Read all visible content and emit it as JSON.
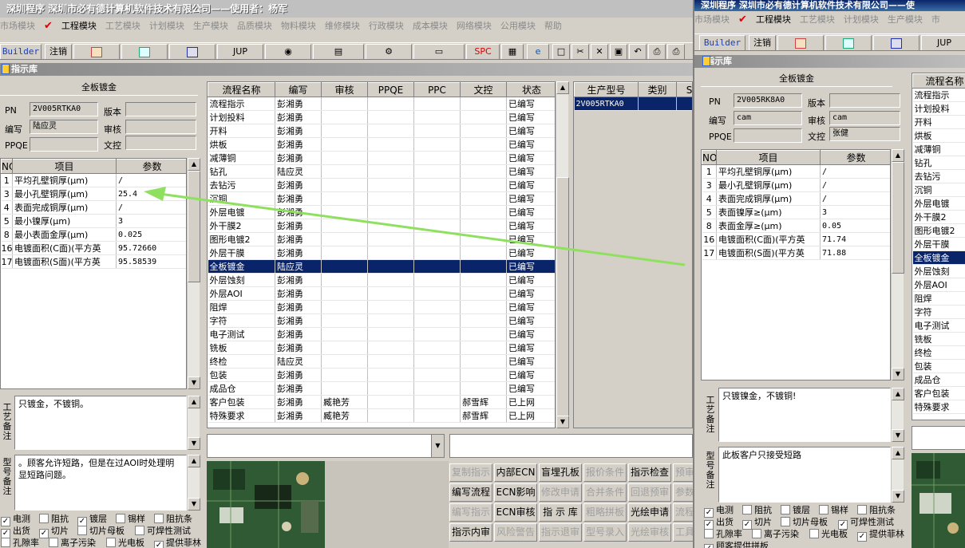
{
  "window1": {
    "title": "深圳程序   深圳市必有德计算机软件技术有限公司——使用者：杨军",
    "menu": [
      "市场模块",
      "工程模块",
      "工艺模块",
      "计划模块",
      "生产模块",
      "品质模块",
      "物料模块",
      "维修模块",
      "行政模块",
      "成本模块",
      "网络模块",
      "公用模块",
      "帮助"
    ],
    "toolbar": {
      "builder": "Builder",
      "logout": "注销",
      "jup": "JUP",
      "spc": "SPC"
    },
    "panel_title": "指示库",
    "process_name": "全板镀金",
    "pn_label": "PN",
    "pn_value": "2V005RTKA0",
    "version_label": "版本",
    "version_value": "",
    "writer_label": "编写",
    "writer_value": "陆应灵",
    "reviewer_label": "审核",
    "reviewer_value": "",
    "ppqe_label": "PPQE",
    "ppqe_value": "",
    "doc_label": "文控",
    "doc_value": "",
    "param_headers": [
      "NO",
      "项目",
      "参数"
    ],
    "params": [
      {
        "no": "1",
        "item": "平均孔壁铜厚(μm)",
        "value": "/"
      },
      {
        "no": "3",
        "item": "最小孔壁铜厚(μm)",
        "value": "25.4"
      },
      {
        "no": "4",
        "item": "表面完成铜厚(μm)",
        "value": "/"
      },
      {
        "no": "5",
        "item": "最小镍厚(μm)",
        "value": "3"
      },
      {
        "no": "8",
        "item": "最小表面金厚(μm)",
        "value": "0.025"
      },
      {
        "no": "16",
        "item": "电镀面积(C面)(平方英",
        "value": "95.72660"
      },
      {
        "no": "17",
        "item": "电镀面积(S面)(平方英",
        "value": "95.58539"
      }
    ],
    "process_headers": [
      "流程名称",
      "编写",
      "审核",
      "PPQE",
      "PPC",
      "文控",
      "状态"
    ],
    "processes": [
      [
        "流程指示",
        "彭湘勇",
        "",
        "",
        "",
        "",
        "已编写"
      ],
      [
        "计划投料",
        "彭湘勇",
        "",
        "",
        "",
        "",
        "已编写"
      ],
      [
        "开料",
        "彭湘勇",
        "",
        "",
        "",
        "",
        "已编写"
      ],
      [
        "烘板",
        "彭湘勇",
        "",
        "",
        "",
        "",
        "已编写"
      ],
      [
        "减薄铜",
        "彭湘勇",
        "",
        "",
        "",
        "",
        "已编写"
      ],
      [
        "钻孔",
        "陆应灵",
        "",
        "",
        "",
        "",
        "已编写"
      ],
      [
        "去钻污",
        "彭湘勇",
        "",
        "",
        "",
        "",
        "已编写"
      ],
      [
        "沉铜",
        "彭湘勇",
        "",
        "",
        "",
        "",
        "已编写"
      ],
      [
        "外层电镀",
        "彭湘勇",
        "",
        "",
        "",
        "",
        "已编写"
      ],
      [
        "外干膜2",
        "彭湘勇",
        "",
        "",
        "",
        "",
        "已编写"
      ],
      [
        "图形电镀2",
        "彭湘勇",
        "",
        "",
        "",
        "",
        "已编写"
      ],
      [
        "外层干膜",
        "彭湘勇",
        "",
        "",
        "",
        "",
        "已编写"
      ],
      [
        "全板镀金",
        "陆应灵",
        "",
        "",
        "",
        "",
        "已编写"
      ],
      [
        "外层蚀刻",
        "彭湘勇",
        "",
        "",
        "",
        "",
        "已编写"
      ],
      [
        "外层AOI",
        "彭湘勇",
        "",
        "",
        "",
        "",
        "已编写"
      ],
      [
        "阻焊",
        "彭湘勇",
        "",
        "",
        "",
        "",
        "已编写"
      ],
      [
        "字符",
        "彭湘勇",
        "",
        "",
        "",
        "",
        "已编写"
      ],
      [
        "电子测试",
        "彭湘勇",
        "",
        "",
        "",
        "",
        "已编写"
      ],
      [
        "铣板",
        "彭湘勇",
        "",
        "",
        "",
        "",
        "已编写"
      ],
      [
        "终检",
        "陆应灵",
        "",
        "",
        "",
        "",
        "已编写"
      ],
      [
        "包装",
        "彭湘勇",
        "",
        "",
        "",
        "",
        "已编写"
      ],
      [
        "成品仓",
        "彭湘勇",
        "",
        "",
        "",
        "",
        "已编写"
      ],
      [
        "客户包装",
        "彭湘勇",
        "臧艳芳",
        "",
        "",
        "郝雪辉",
        "已上网"
      ],
      [
        "特殊要求",
        "彭湘勇",
        "臧艳芳",
        "",
        "",
        "郝雪辉",
        "已上网"
      ]
    ],
    "model_headers": [
      "生产型号",
      "类别",
      "S"
    ],
    "models": [
      [
        "2V005RTKA0",
        "",
        ""
      ]
    ],
    "craft_note_label": "工艺备注",
    "craft_note": "只镀金，不镀铜。",
    "model_note_label": "型号备注",
    "model_note": "。顾客允许短路，但是在过AOI时处理明显短路问题。",
    "checks_row1": [
      {
        "t": "电测",
        "c": true
      },
      {
        "t": "阻抗",
        "c": false
      },
      {
        "t": "镀层",
        "c": true
      },
      {
        "t": "锡样",
        "c": false
      },
      {
        "t": "阻抗条",
        "c": false
      }
    ],
    "checks_row2": [
      {
        "t": "出货",
        "c": true
      },
      {
        "t": "切片",
        "c": true
      },
      {
        "t": "切片母板",
        "c": false
      },
      {
        "t": "可焊性测试",
        "c": false
      }
    ],
    "checks_row3": [
      {
        "t": "孔隙率",
        "c": false
      },
      {
        "t": "离子污染",
        "c": false
      },
      {
        "t": "光电板",
        "c": false
      },
      {
        "t": "提供菲林",
        "c": true
      }
    ],
    "buttons": [
      [
        {
          "t": "复制指示",
          "d": true
        },
        {
          "t": "内部ECN",
          "d": false
        },
        {
          "t": "盲埋孔板",
          "d": false
        },
        {
          "t": "报价条件",
          "d": true
        },
        {
          "t": "指示检查",
          "d": false
        },
        {
          "t": "预审",
          "d": true
        }
      ],
      [
        {
          "t": "编写流程",
          "d": false
        },
        {
          "t": "ECN影响",
          "d": false
        },
        {
          "t": "修改申请",
          "d": true
        },
        {
          "t": "合并条件",
          "d": true
        },
        {
          "t": "回退预审",
          "d": true
        },
        {
          "t": "参数",
          "d": true
        }
      ],
      [
        {
          "t": "编写指示",
          "d": true
        },
        {
          "t": "ECN审核",
          "d": false
        },
        {
          "t": "指 示 库",
          "d": false
        },
        {
          "t": "粗略拼板",
          "d": true
        },
        {
          "t": "光绘申请",
          "d": false
        },
        {
          "t": "流程",
          "d": true
        }
      ],
      [
        {
          "t": "指示内审",
          "d": false
        },
        {
          "t": "风险警告",
          "d": true
        },
        {
          "t": "指示退审",
          "d": true
        },
        {
          "t": "型号录入",
          "d": true
        },
        {
          "t": "光绘审核",
          "d": true
        },
        {
          "t": "工具",
          "d": true
        }
      ]
    ]
  },
  "window2": {
    "title": "深圳程序   深圳市必有德计算机软件技术有限公司——使",
    "menu": [
      "市场模块",
      "工程模块",
      "工艺模块",
      "计划模块",
      "生产模块",
      "市"
    ],
    "toolbar": {
      "builder": "Builder",
      "logout": "注销",
      "jup": "JUP"
    },
    "panel_title": "指示库",
    "process_name": "全板镀金",
    "pn_label": "PN",
    "pn_value": "2V005RK8A0",
    "version_label": "版本",
    "version_value": "",
    "writer_label": "编写",
    "writer_value": "cam",
    "reviewer_label": "审核",
    "reviewer_value": "cam",
    "ppqe_label": "PPQE",
    "ppqe_value": "",
    "doc_label": "文控",
    "doc_value": "张健",
    "param_headers": [
      "NO",
      "项目",
      "参数"
    ],
    "params": [
      {
        "no": "1",
        "item": "平均孔壁铜厚(μm)",
        "value": "/"
      },
      {
        "no": "3",
        "item": "最小孔壁铜厚(μm)",
        "value": "/"
      },
      {
        "no": "4",
        "item": "表面完成铜厚(μm)",
        "value": "/"
      },
      {
        "no": "5",
        "item": "表面镍厚≥(μm)",
        "value": "3"
      },
      {
        "no": "8",
        "item": "表面金厚≥(μm)",
        "value": "0.05"
      },
      {
        "no": "16",
        "item": "电镀面积(C面)(平方英",
        "value": "71.74"
      },
      {
        "no": "17",
        "item": "电镀面积(S面)(平方英",
        "value": "71.88"
      }
    ],
    "process_header": "流程名称",
    "processes": [
      "流程指示",
      "计划投料",
      "开料",
      "烘板",
      "减薄铜",
      "钻孔",
      "去钻污",
      "沉铜",
      "外层电镀",
      "外干膜2",
      "图形电镀2",
      "外层干膜",
      "全板镀金",
      "外层蚀刻",
      "外层AOI",
      "阻焊",
      "字符",
      "电子测试",
      "铣板",
      "终检",
      "包装",
      "成品仓",
      "客户包装",
      "特殊要求"
    ],
    "craft_note_label": "工艺备注",
    "craft_note": "只镀镍金，不镀铜!",
    "model_note_label": "型号备注",
    "model_note": "此板客户只接受短路",
    "checks_row1": [
      {
        "t": "电测",
        "c": true
      },
      {
        "t": "阻抗",
        "c": false
      },
      {
        "t": "镀层",
        "c": false
      },
      {
        "t": "锡样",
        "c": false
      },
      {
        "t": "阻抗条",
        "c": false
      }
    ],
    "checks_row2": [
      {
        "t": "出货",
        "c": true
      },
      {
        "t": "切片",
        "c": true
      },
      {
        "t": "切片母板",
        "c": false
      },
      {
        "t": "可焊性测试",
        "c": true
      }
    ],
    "checks_row3": [
      {
        "t": "孔隙率",
        "c": false
      },
      {
        "t": "离子污染",
        "c": false
      },
      {
        "t": "光电板",
        "c": false
      },
      {
        "t": "提供菲林",
        "c": true
      }
    ],
    "checks_row4": [
      {
        "t": "顾客提供拼板",
        "c": true
      }
    ]
  },
  "colors": {
    "selection": "#0a246a",
    "arrow": "#90e060",
    "face": "#d4d0c8"
  }
}
